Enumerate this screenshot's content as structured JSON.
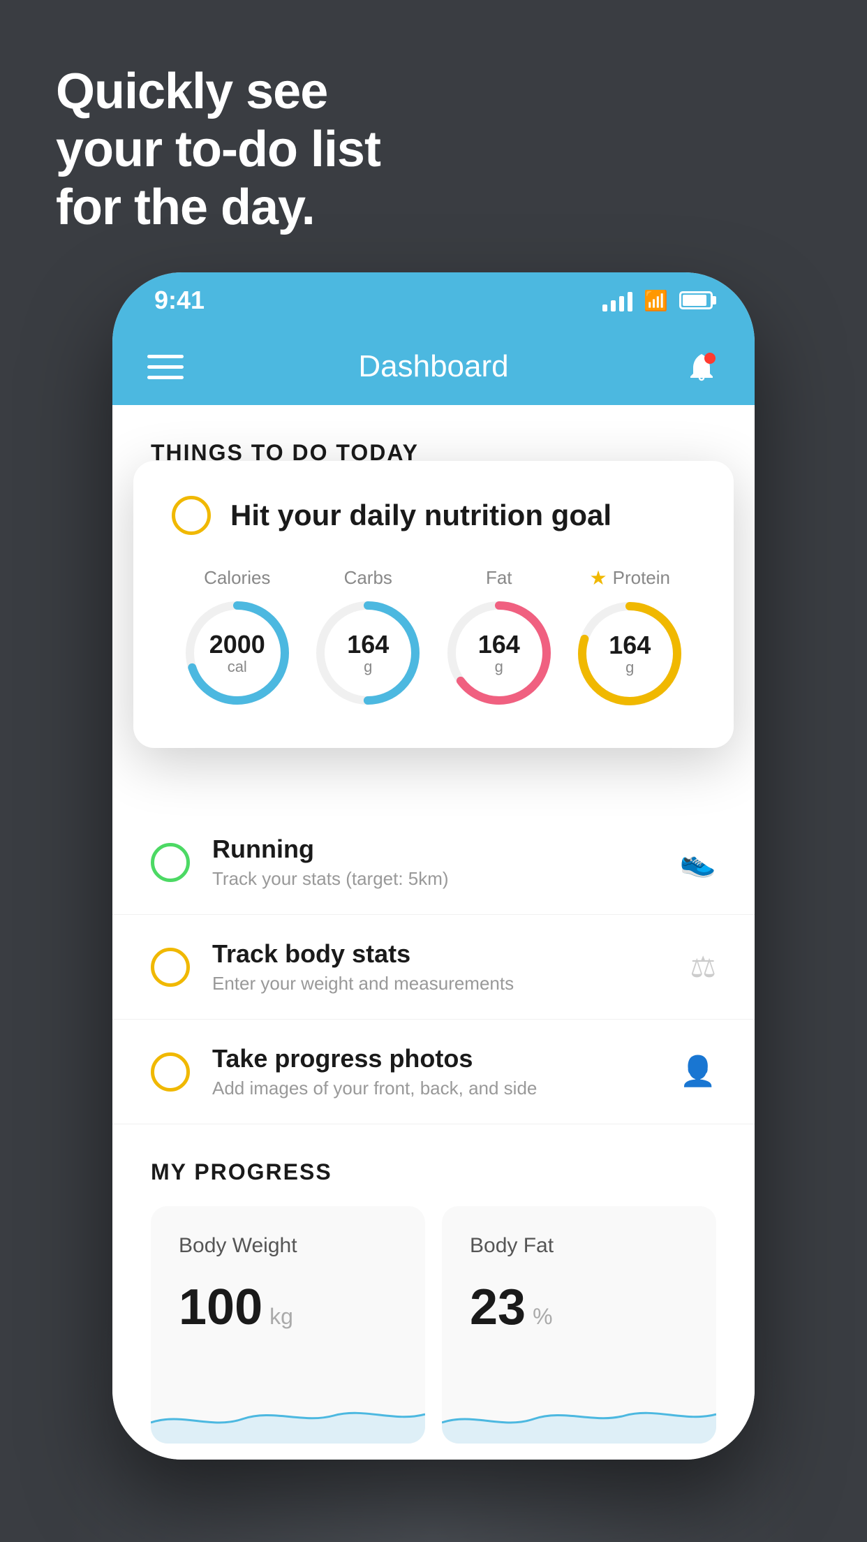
{
  "hero": {
    "line1": "Quickly see",
    "line2": "your to-do list",
    "line3": "for the day."
  },
  "phone": {
    "statusBar": {
      "time": "9:41"
    },
    "navBar": {
      "title": "Dashboard"
    },
    "sectionHeader": "THINGS TO DO TODAY",
    "floatingCard": {
      "circleColor": "#f0b800",
      "title": "Hit your daily nutrition goal",
      "macros": [
        {
          "label": "Calories",
          "value": "2000",
          "unit": "cal",
          "color": "#4cb8e0",
          "progress": 0.7,
          "starred": false
        },
        {
          "label": "Carbs",
          "value": "164",
          "unit": "g",
          "color": "#4cb8e0",
          "progress": 0.5,
          "starred": false
        },
        {
          "label": "Fat",
          "value": "164",
          "unit": "g",
          "color": "#f06080",
          "progress": 0.65,
          "starred": false
        },
        {
          "label": "Protein",
          "value": "164",
          "unit": "g",
          "color": "#f0b800",
          "progress": 0.8,
          "starred": true
        }
      ]
    },
    "todoItems": [
      {
        "id": "running",
        "circleColor": "green",
        "title": "Running",
        "subtitle": "Track your stats (target: 5km)",
        "icon": "👟"
      },
      {
        "id": "body-stats",
        "circleColor": "yellow",
        "title": "Track body stats",
        "subtitle": "Enter your weight and measurements",
        "icon": "⚖"
      },
      {
        "id": "photos",
        "circleColor": "yellow",
        "title": "Take progress photos",
        "subtitle": "Add images of your front, back, and side",
        "icon": "👤"
      }
    ],
    "progressSection": {
      "header": "MY PROGRESS",
      "cards": [
        {
          "title": "Body Weight",
          "value": "100",
          "unit": "kg"
        },
        {
          "title": "Body Fat",
          "value": "23",
          "unit": "%"
        }
      ]
    }
  }
}
